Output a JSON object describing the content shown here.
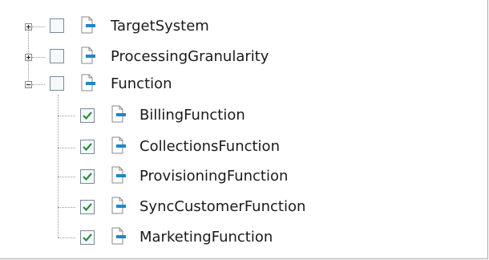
{
  "tree": {
    "nodes": [
      {
        "label": "TargetSystem",
        "expander": "collapsed",
        "checked": false,
        "level": 0
      },
      {
        "label": "ProcessingGranularity",
        "expander": "collapsed",
        "checked": false,
        "level": 0
      },
      {
        "label": "Function",
        "expander": "expanded",
        "checked": false,
        "level": 0,
        "children": [
          {
            "label": "BillingFunction",
            "checked": true,
            "level": 1
          },
          {
            "label": "CollectionsFunction",
            "checked": true,
            "level": 1
          },
          {
            "label": "ProvisioningFunction",
            "checked": true,
            "level": 1
          },
          {
            "label": "SyncCustomerFunction",
            "checked": true,
            "level": 1
          },
          {
            "label": "MarketingFunction",
            "checked": true,
            "level": 1
          }
        ]
      }
    ]
  },
  "icons": {
    "node_icon": "document-icon",
    "check_icon": "checkmark-icon"
  },
  "colors": {
    "check": "#2e8b3a",
    "icon_blue": "#1e88c7",
    "line": "#9a9a9a"
  }
}
